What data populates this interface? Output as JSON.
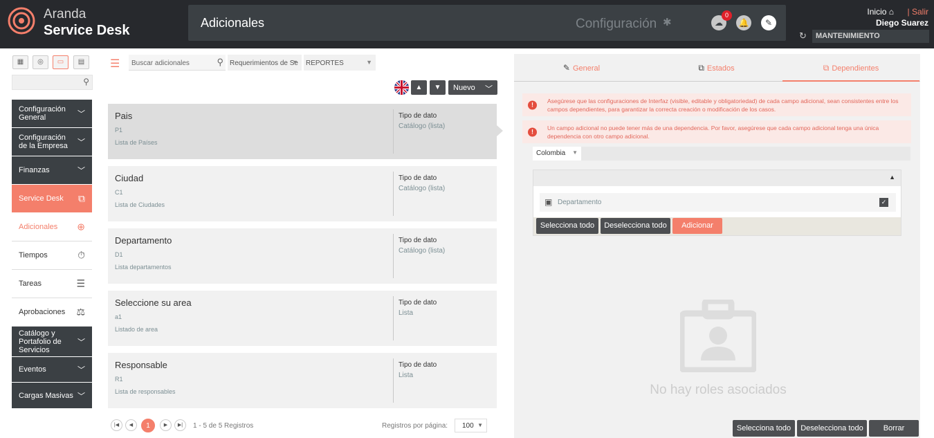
{
  "brand": {
    "line1": "Aranda",
    "line2": "Service Desk"
  },
  "header": {
    "title": "Adicionales",
    "config_label": "Configuración",
    "notification_count": "0",
    "inicio": "Inicio",
    "salir": "| Salir",
    "user_name": "Diego Suarez",
    "project": "MANTENIMIENTO"
  },
  "sidebar": {
    "items": [
      {
        "label": "Configuración General"
      },
      {
        "label": "Configuración de la Empresa"
      },
      {
        "label": "Finanzas"
      },
      {
        "label": "Service Desk"
      },
      {
        "label": "Adicionales"
      },
      {
        "label": "Tiempos"
      },
      {
        "label": "Tareas"
      },
      {
        "label": "Aprobaciones"
      },
      {
        "label": "Catálogo y Portafolio de Servicios"
      },
      {
        "label": "Eventos"
      },
      {
        "label": "Cargas Masivas"
      }
    ]
  },
  "toolbar": {
    "search_placeholder": "Buscar adicionales",
    "filter1": "Requerimientos de Se",
    "filter2": "REPORTES",
    "new_label": "Nuevo"
  },
  "cards": [
    {
      "name": "Pais",
      "code": "P1",
      "desc": "Lista de Países",
      "type_label": "Tipo de dato",
      "type": "Catálogo (lista)"
    },
    {
      "name": "Ciudad",
      "code": "C1",
      "desc": "Lista de Ciudades",
      "type_label": "Tipo de dato",
      "type": "Catálogo (lista)"
    },
    {
      "name": "Departamento",
      "code": "D1",
      "desc": "Lista departamentos",
      "type_label": "Tipo de dato",
      "type": "Catálogo (lista)"
    },
    {
      "name": "Seleccione su area",
      "code": "a1",
      "desc": "Listado de area",
      "type_label": "Tipo de dato",
      "type": "Lista"
    },
    {
      "name": "Responsable",
      "code": "R1",
      "desc": "Lista de responsables",
      "type_label": "Tipo de dato",
      "type": "Lista"
    }
  ],
  "pagination": {
    "current": "1",
    "info": "1 - 5 de 5 Registros",
    "per_page_label": "Registros por página:",
    "per_page": "100"
  },
  "detail": {
    "tabs": [
      "General",
      "Estados",
      "Dependientes"
    ],
    "warning1": "Asegúrese que las configuraciones de Interfaz (visible, editable y obligatoriedad) de cada campo adicional, sean consistentes entre los campos dependientes, para garantizar la correcta creación o modificación de los casos.",
    "warning2": "Un campo adicional no puede tener más de una dependencia. Por favor, asegúrese que cada campo adicional tenga una única dependencia con otro campo adicional.",
    "country": "Colombia",
    "dep_item": "Departamento",
    "select_all": "Selecciona todo",
    "deselect_all": "Deselecciona todo",
    "add": "Adicionar",
    "empty_text": "No hay roles asociados",
    "delete": "Borrar"
  },
  "colors": {
    "accent": "#f47f6b",
    "dark": "#3b4044"
  }
}
